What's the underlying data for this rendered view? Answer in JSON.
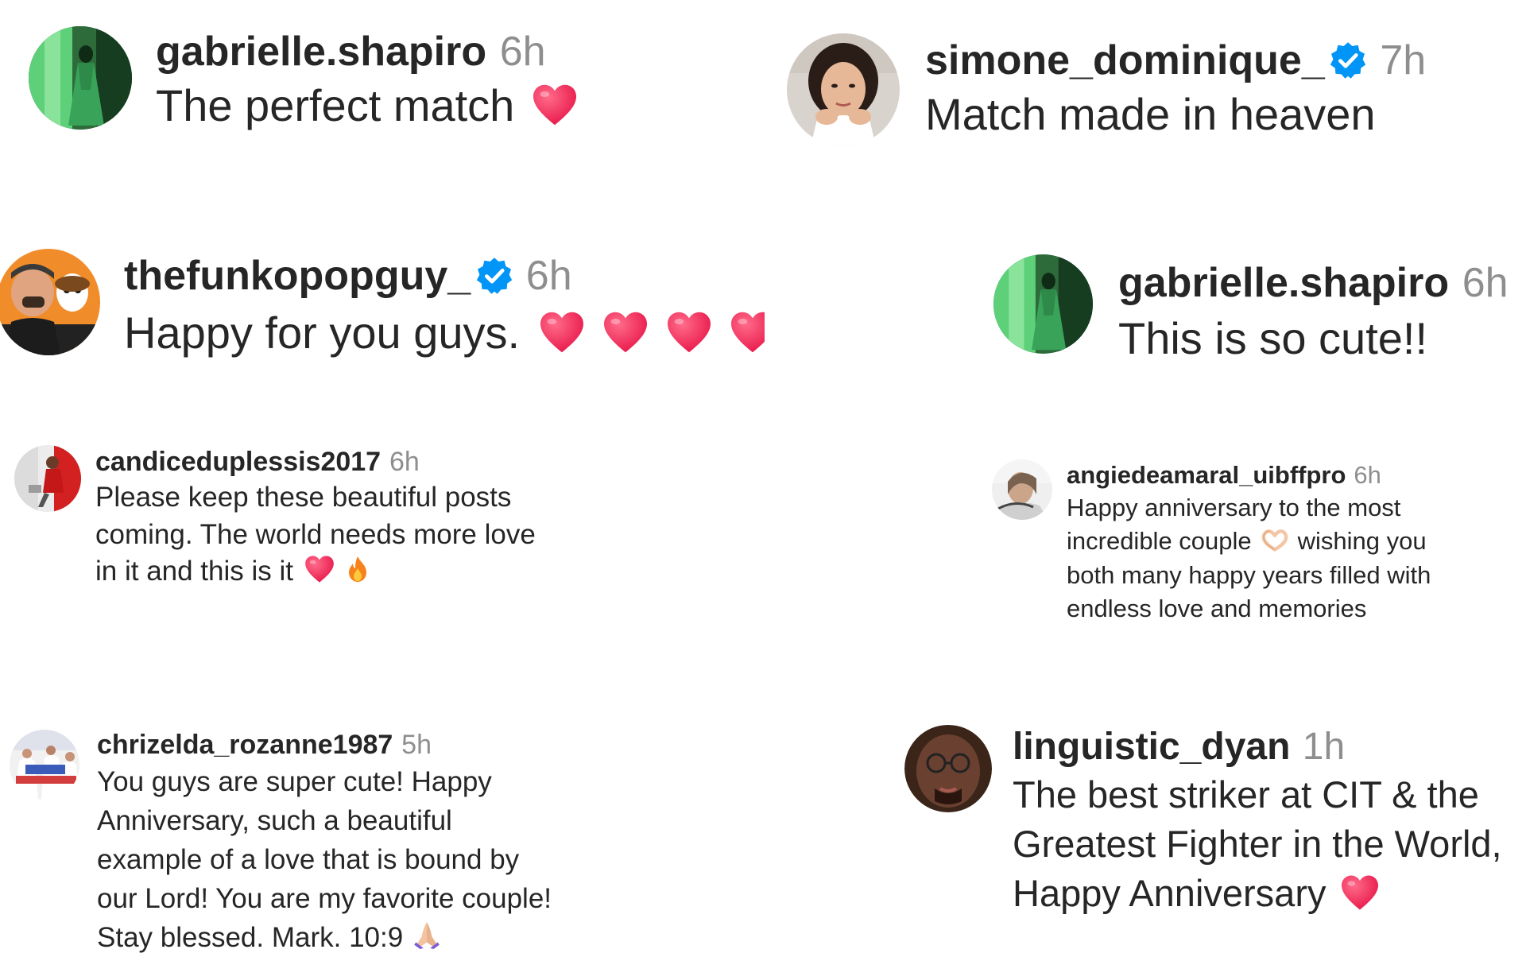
{
  "comments": [
    {
      "username": "gabrielle.shapiro",
      "time": "6h",
      "text": "The perfect match",
      "verified": false,
      "emojis": [
        "heart-emoji"
      ]
    },
    {
      "username": "simone_dominique_",
      "time": "7h",
      "text": "Match made in heaven",
      "verified": true,
      "emojis": []
    },
    {
      "username": "thefunkopopguy_",
      "time": "6h",
      "text": "Happy for you guys.",
      "verified": true,
      "emojis": [
        "heart-emoji",
        "heart-emoji",
        "heart-emoji",
        "heart-emoji"
      ]
    },
    {
      "username": "gabrielle.shapiro",
      "time": "6h",
      "text": "This is so cute!!",
      "verified": false,
      "emojis": []
    },
    {
      "username": "candiceduplessis2017",
      "time": "6h",
      "text": "Please keep these beautiful posts coming. The world needs more love in it and this is it",
      "verified": false,
      "emojis": [
        "heart-emoji",
        "fire-emoji"
      ]
    },
    {
      "username": "angiedeamaral_uibffpro",
      "time": "6h",
      "text_before": "Happy anniversary to the most incredible couple",
      "text_after": "wishing you both many happy years filled with endless love and memories",
      "verified": false,
      "emojis": [
        "heart-hands-emoji"
      ]
    },
    {
      "username": "chrizelda_rozanne1987",
      "time": "5h",
      "text": "You guys are super cute! Happy Anniversary, such a beautiful example of a love that is bound by our Lord! You are my favorite couple! Stay blessed. Mark. 10:9",
      "verified": false,
      "emojis": [
        "praying-hands-emoji"
      ]
    },
    {
      "username": "linguistic_dyan",
      "time": "1h",
      "text": "The best striker at CIT & the Greatest Fighter in the World, Happy Anniversary",
      "verified": false,
      "emojis": [
        "heart-emoji"
      ]
    }
  ],
  "colors": {
    "username": "#262626",
    "timestamp": "#8e8e8e",
    "verified_badge": "#0095f6",
    "heart": "#f0285a"
  }
}
